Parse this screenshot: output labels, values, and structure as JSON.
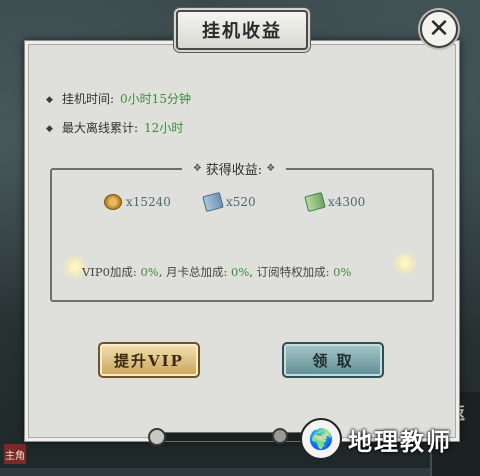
{
  "dialog": {
    "title": "挂机收益",
    "close_label": "✕"
  },
  "info": {
    "idle_time_label": "挂机时间:",
    "idle_time_value": "0小时15分钟",
    "max_offline_label": "最大离线累计:",
    "max_offline_value": "12小时"
  },
  "rewards": {
    "header": "获得收益:",
    "items": [
      {
        "icon": "coin-icon",
        "amount": "x15240"
      },
      {
        "icon": "blue-scroll-icon",
        "amount": "x520"
      },
      {
        "icon": "green-scroll-icon",
        "amount": "x4300"
      }
    ]
  },
  "bonus": {
    "vip_label": "VIP0加成:",
    "vip_value": "0%",
    "monthly_label": "月卡总加成:",
    "monthly_value": "0%",
    "subscription_label": "订阅特权加成:",
    "subscription_value": "0%"
  },
  "buttons": {
    "upgrade_vip": "提升VIP",
    "claim": "领 取"
  },
  "side": {
    "right_tag": "返",
    "left_tag": "主角"
  },
  "watermark": {
    "text": "地理教师"
  }
}
